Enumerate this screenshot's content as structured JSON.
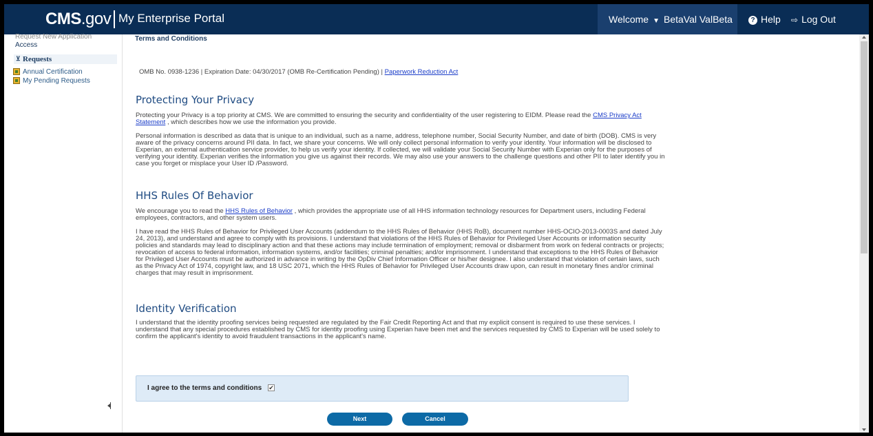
{
  "header": {
    "logo_cms": "CMS",
    "logo_gov": ".gov",
    "portal_title": "My Enterprise Portal",
    "welcome_label": "Welcome",
    "user_name": "BetaVal ValBeta",
    "help_label": "Help",
    "logout_label": "Log Out"
  },
  "sidebar": {
    "cut_item": "Request New Application",
    "access_label": "Access",
    "section_title": "Requests",
    "items": [
      {
        "label": "Annual Certification"
      },
      {
        "label": "My Pending Requests"
      }
    ]
  },
  "main": {
    "section_title": "Terms and Conditions",
    "omb_text": "OMB No. 0938-1236  |  Expiration Date: 04/30/2017 (OMB Re-Certification Pending)  |",
    "omb_link": "Paperwork Reduction Act",
    "privacy": {
      "heading": "Protecting Your Privacy",
      "p1_before": "Protecting your Privacy is a top priority at CMS. We are committed to ensuring the security and confidentiality of the user registering to EIDM. Please read the ",
      "p1_link": "CMS Privacy Act Statement",
      "p1_after": " , which describes how we use the information you provide.",
      "p2": "Personal information is described as data that is unique to an individual, such as a name, address, telephone number, Social Security Number, and date of birth (DOB). CMS is very aware of the privacy concerns around PII data. In fact, we share your concerns. We will only collect personal information to verify your identity. Your information will be disclosed to Experian, an external authentication service provider, to help us verify your identity. If collected, we will validate your Social Security Number with Experian only for the purposes of verifying your identity. Experian verifies the information you give us against their records. We may also use your answers to the challenge questions and other PII to later identify you in case you forget or misplace your User ID /Password."
    },
    "hhs": {
      "heading": "HHS Rules Of Behavior",
      "p1_before": "We encourage you to read the ",
      "p1_link": "HHS Rules of Behavior",
      "p1_after": " , which provides the appropriate use of all HHS information technology resources for Department users, including Federal employees, contractors, and other system users.",
      "p2": "I have read the HHS Rules of Behavior for Privileged User Accounts (addendum to the HHS Rules of Behavior (HHS RoB), document number HHS-OCIO-2013-0003S and dated July 24, 2013), and understand and agree to comply with its provisions. I understand that violations of the HHS Rules of Behavior for Privileged User Accounts or information security policies and standards may lead to disciplinary action and that these actions may include termination of employment; removal or disbarment from work on federal contracts or projects; revocation of access to federal information, information systems, and/or facilities; criminal penalties; and/or imprisonment. I understand that exceptions to the HHS Rules of Behavior for Privileged User Accounts must be authorized in advance in writing by the OpDiv Chief Information Officer or his/her designee. I also understand that violation of certain laws, such as the Privacy Act of 1974, copyright law, and 18 USC 2071, which the HHS Rules of Behavior for Privileged User Accounts draw upon, can result in monetary fines and/or criminal charges that may result in imprisonment."
    },
    "identity": {
      "heading": "Identity Verification",
      "p1": "I understand that the identity proofing services being requested are regulated by the Fair Credit Reporting Act and that my explicit consent is required to use these services. I understand that any special procedures established by CMS for identity proofing using Experian have been met and the services requested by CMS to Experian will be used solely to confirm the applicant's identity to avoid fraudulent transactions in the applicant's name."
    },
    "agree_label": "I agree to the terms and conditions",
    "agree_checked": "✔",
    "next_label": "Next",
    "cancel_label": "Cancel"
  },
  "colors": {
    "header_bg": "#0a2d55",
    "button_bg": "#0d6aa6",
    "heading_color": "#1f4b82",
    "agree_box_bg": "#deebf7"
  }
}
